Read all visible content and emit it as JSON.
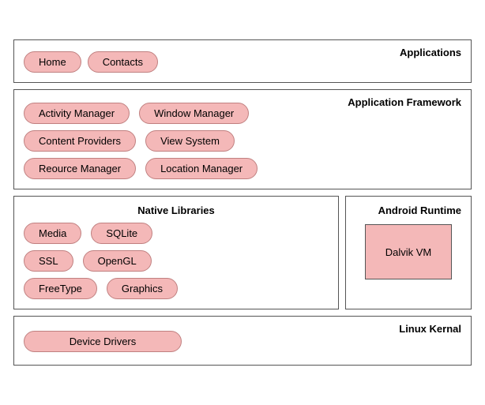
{
  "layers": {
    "applications": {
      "label": "Applications",
      "pills": [
        "Home",
        "Contacts"
      ]
    },
    "appframework": {
      "label": "Application Framework",
      "rows": [
        [
          "Activity Manager",
          "Window Manager"
        ],
        [
          "Content Providers",
          "View System"
        ],
        [
          "Reource Manager",
          "Location  Manager"
        ]
      ]
    },
    "native": {
      "label": "Native Libraries",
      "rows": [
        [
          "Media",
          "SQLite"
        ],
        [
          "SSL",
          "OpenGL"
        ],
        [
          "FreeType",
          "Graphics"
        ]
      ]
    },
    "runtime": {
      "label": "Android Runtime",
      "dalvik": "Dalvik VM"
    },
    "linux": {
      "label": "Linux Kernal",
      "pill": "Device Drivers"
    }
  }
}
